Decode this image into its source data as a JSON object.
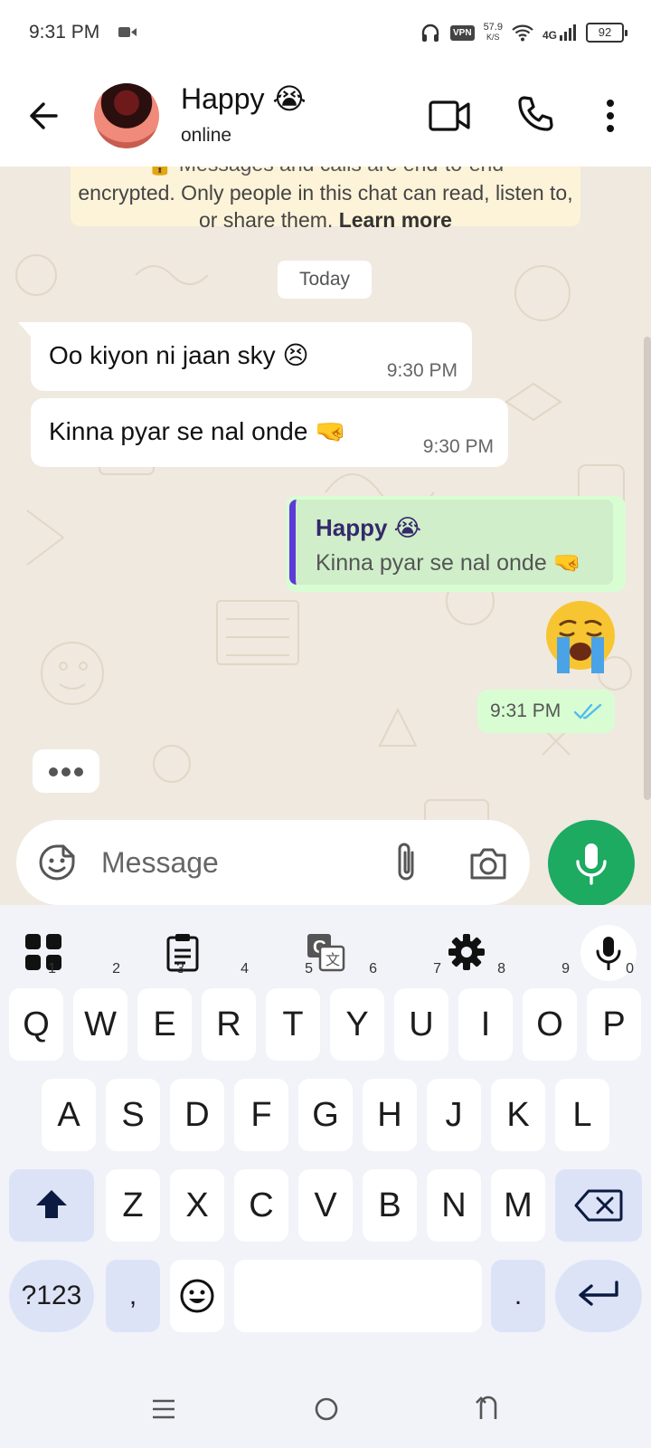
{
  "status_bar": {
    "time": "9:31 PM",
    "vpn": "VPN",
    "speed_value": "57.9",
    "speed_unit": "K/S",
    "network": "4G",
    "battery": "92"
  },
  "app_bar": {
    "contact_name": "Happy 😭",
    "contact_status": "online"
  },
  "chat": {
    "encryption_notice": "encrypted. Only people in this chat can read, listen to, or share them.",
    "encryption_notice_top": "🔒 Messages and calls are end-to-end",
    "learn_more": "Learn more",
    "date_chip": "Today",
    "messages": [
      {
        "direction": "in",
        "text": "Oo kiyon ni jaan sky 😣",
        "time": "9:30 PM"
      },
      {
        "direction": "in",
        "text": "Kinna pyar se nal onde 🤜",
        "time": "9:30 PM"
      }
    ],
    "reply": {
      "quoted_name": "Happy 😭",
      "quoted_text": "Kinna pyar se nal onde 🤜",
      "emoji": "😭",
      "time": "9:31 PM",
      "status": "read"
    }
  },
  "composer": {
    "placeholder": "Message"
  },
  "keyboard": {
    "row1": [
      {
        "key": "Q",
        "hint": "1"
      },
      {
        "key": "W",
        "hint": "2"
      },
      {
        "key": "E",
        "hint": "3"
      },
      {
        "key": "R",
        "hint": "4"
      },
      {
        "key": "T",
        "hint": "5"
      },
      {
        "key": "Y",
        "hint": "6"
      },
      {
        "key": "U",
        "hint": "7"
      },
      {
        "key": "I",
        "hint": "8"
      },
      {
        "key": "O",
        "hint": "9"
      },
      {
        "key": "P",
        "hint": "0"
      }
    ],
    "row2": [
      "A",
      "S",
      "D",
      "F",
      "G",
      "H",
      "J",
      "K",
      "L"
    ],
    "row3": [
      "Z",
      "X",
      "C",
      "V",
      "B",
      "N",
      "M"
    ],
    "symbols_key": "?123",
    "comma_key": ",",
    "period_key": "."
  },
  "colors": {
    "accent_green": "#1daa61",
    "outgoing_bubble": "#d9fdd3",
    "chat_background": "#efe9df",
    "read_ticks": "#53bdeb",
    "reply_bar": "#5b3bd6"
  }
}
